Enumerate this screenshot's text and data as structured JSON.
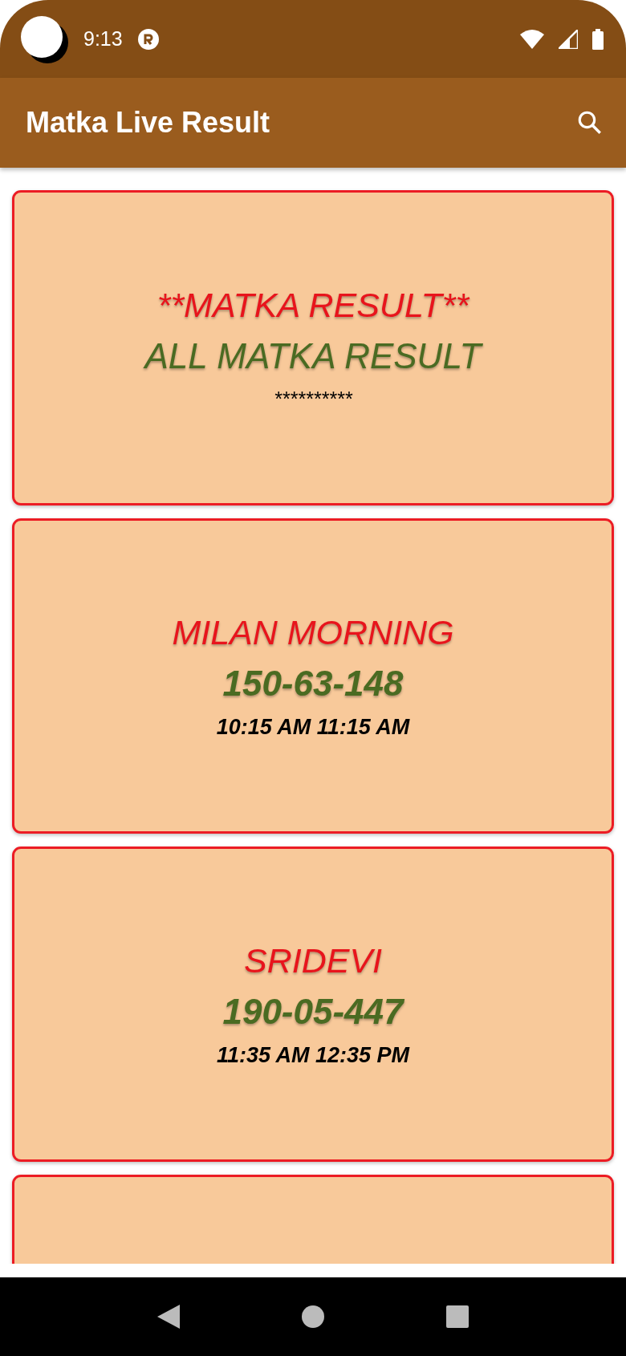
{
  "status_bar": {
    "time": "9:13"
  },
  "app_bar": {
    "title": "Matka Live Result"
  },
  "cards": [
    {
      "kind": "header",
      "title": "**MATKA RESULT**",
      "subtitle": "ALL MATKA RESULT",
      "note": "**********"
    },
    {
      "kind": "game",
      "title": "MILAN MORNING",
      "subtitle": "150-63-148",
      "note": "10:15 AM 11:15 AM"
    },
    {
      "kind": "game",
      "title": "SRIDEVI",
      "subtitle": "190-05-447",
      "note": "11:35 AM 12:35 PM"
    },
    {
      "kind": "blank"
    }
  ]
}
